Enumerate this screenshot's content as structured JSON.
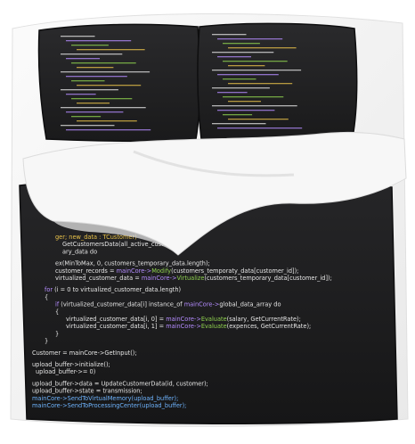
{
  "image": {
    "subject": "duvet-cover-set-with-code-print",
    "colors": {
      "background": "#ffffff",
      "fabric": "#1c1c1e",
      "fabric_edge": "#0f0f10",
      "sheet": "#f4f4f4",
      "sheet_shadow": "#d9d9d9",
      "code_white": "#e6e6e6",
      "code_purple": "#b48cff",
      "code_green": "#8fd14f",
      "code_yellow": "#e8c24a",
      "code_blue": "#6fb5ff"
    }
  },
  "duvet_code": {
    "lines": [
      {
        "segments": [
          {
            "t": "ger; new_data : TCustomer)",
            "c": "code_yellow"
          }
        ]
      },
      {
        "segments": [
          {
            "t": "GetCustomersData(all_active_customers);",
            "c": "code_white"
          }
        ]
      },
      {
        "segments": [
          {
            "t": "ary_data do",
            "c": "code_white"
          }
        ]
      },
      {
        "segments": [
          {
            "t": ""
          }
        ]
      },
      {
        "segments": [
          {
            "t": "ex(MinToMax, 0, customers_temporary_data.length);",
            "c": "code_white"
          }
        ]
      },
      {
        "segments": [
          {
            "t": "customer_records = ",
            "c": "code_white"
          },
          {
            "t": "mainCore->",
            "c": "code_purple"
          },
          {
            "t": "Modify",
            "c": "code_green"
          },
          {
            "t": "(customers_temporaty_data[customer_id]);",
            "c": "code_white"
          }
        ]
      },
      {
        "segments": [
          {
            "t": "virtualized_customer_data = ",
            "c": "code_white"
          },
          {
            "t": "mainCore->",
            "c": "code_purple"
          },
          {
            "t": "Virtualize",
            "c": "code_green"
          },
          {
            "t": "(customers_temporary_data[customer_id]);",
            "c": "code_white"
          }
        ]
      },
      {
        "segments": [
          {
            "t": ""
          }
        ]
      },
      {
        "segments": [
          {
            "t": "for",
            "c": "code_purple"
          },
          {
            "t": " (i = 0 to virtualized_customer_data.length)",
            "c": "code_white"
          }
        ]
      },
      {
        "segments": [
          {
            "t": "{",
            "c": "code_white"
          }
        ]
      },
      {
        "segments": [
          {
            "t": "if",
            "c": "code_purple"
          },
          {
            "t": " (virtualized_customer_data[i] instance_of ",
            "c": "code_white"
          },
          {
            "t": "mainCore->",
            "c": "code_purple"
          },
          {
            "t": "global_data_array do",
            "c": "code_white"
          }
        ]
      },
      {
        "segments": [
          {
            "t": "{",
            "c": "code_white"
          }
        ]
      },
      {
        "segments": [
          {
            "t": "virtualized_customer_data[i, 0] = ",
            "c": "code_white"
          },
          {
            "t": "mainCore->",
            "c": "code_purple"
          },
          {
            "t": "Evaluate",
            "c": "code_green"
          },
          {
            "t": "(salary, GetCurrentRate);",
            "c": "code_white"
          }
        ]
      },
      {
        "segments": [
          {
            "t": "virtualized_customer_data[i, 1] = ",
            "c": "code_white"
          },
          {
            "t": "mainCore->",
            "c": "code_purple"
          },
          {
            "t": "Evaluate",
            "c": "code_green"
          },
          {
            "t": "(expences, GetCurrentRate);",
            "c": "code_white"
          }
        ]
      },
      {
        "segments": [
          {
            "t": "}",
            "c": "code_white"
          }
        ]
      },
      {
        "segments": [
          {
            "t": "}",
            "c": "code_white"
          }
        ]
      },
      {
        "segments": [
          {
            "t": ""
          }
        ]
      },
      {
        "segments": [
          {
            "t": "Customer = mainCore->GetInput();",
            "c": "code_white"
          }
        ]
      },
      {
        "segments": [
          {
            "t": ""
          }
        ]
      },
      {
        "segments": [
          {
            "t": "upload_buffer->initialize();",
            "c": "code_white"
          }
        ]
      },
      {
        "segments": [
          {
            "t": "upload_buffer->= 0)",
            "c": "code_white"
          }
        ]
      },
      {
        "segments": [
          {
            "t": ""
          }
        ]
      },
      {
        "segments": [
          {
            "t": "upload_buffer->data = UpdateCustomerData(id, customer);",
            "c": "code_white"
          }
        ]
      },
      {
        "segments": [
          {
            "t": "upload_buffer->state = transmission;",
            "c": "code_white"
          }
        ]
      },
      {
        "segments": [
          {
            "t": "mainCore->SendToVirtualMemory(upload_buffer);",
            "c": "code_blue"
          }
        ]
      },
      {
        "segments": [
          {
            "t": "mainCore->SendToProcessingCenter(upload_buffer);",
            "c": "code_blue"
          }
        ]
      }
    ]
  }
}
